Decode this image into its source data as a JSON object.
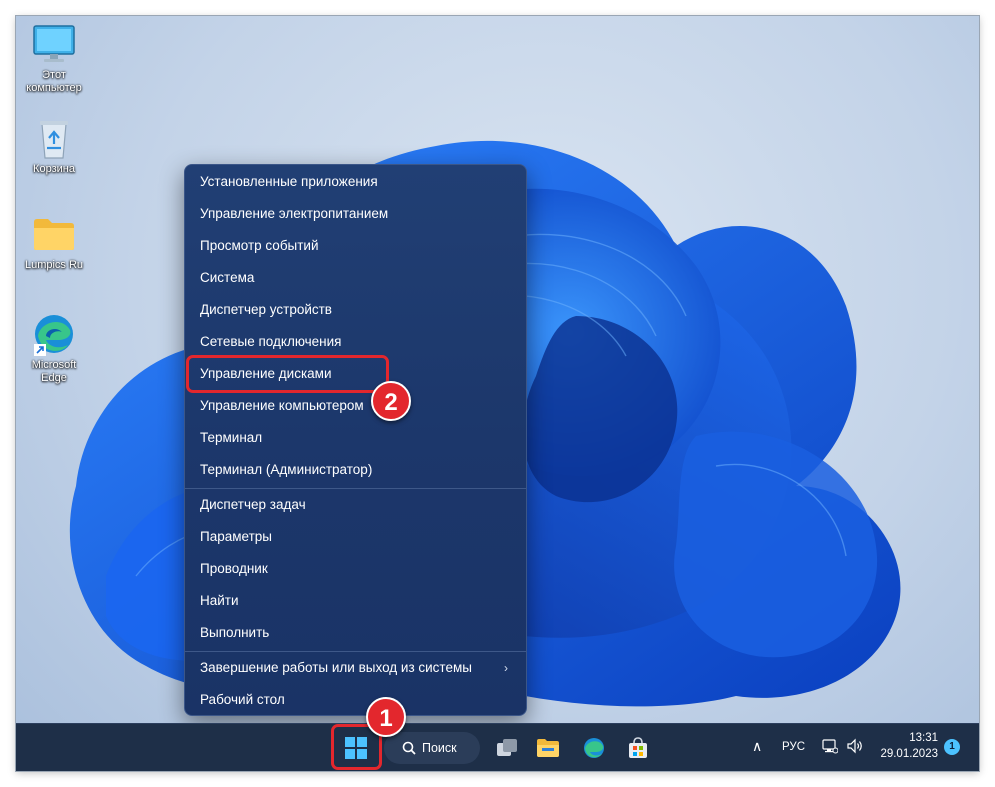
{
  "desktop": {
    "icons": [
      {
        "label": "Этот\nкомпьютер"
      },
      {
        "label": "Корзина"
      },
      {
        "label": "Lumpics Ru"
      },
      {
        "label": "Microsoft\nEdge"
      }
    ]
  },
  "context_menu": {
    "items": [
      {
        "label": "Установленные приложения"
      },
      {
        "label": "Управление электропитанием"
      },
      {
        "label": "Просмотр событий"
      },
      {
        "label": "Система"
      },
      {
        "label": "Диспетчер устройств"
      },
      {
        "label": "Сетевые подключения"
      },
      {
        "label": "Управление дисками"
      },
      {
        "label": "Управление компьютером"
      },
      {
        "label": "Терминал"
      },
      {
        "label": "Терминал (Администратор)"
      },
      {
        "label": "Диспетчер задач"
      },
      {
        "label": "Параметры"
      },
      {
        "label": "Проводник"
      },
      {
        "label": "Найти"
      },
      {
        "label": "Выполнить"
      },
      {
        "label": "Завершение работы или выход из системы"
      },
      {
        "label": "Рабочий стол"
      }
    ]
  },
  "taskbar": {
    "search_label": "Поиск",
    "language": "РУС",
    "time": "13:31",
    "date": "29.01.2023",
    "notification_count": "1"
  },
  "annotations": {
    "step1": "1",
    "step2": "2"
  },
  "colors": {
    "accent_red": "#e3272d",
    "menu_background": "#1d3a6b",
    "taskbar_background": "#1e2f48",
    "wallpaper_blue": "#1561e8"
  }
}
